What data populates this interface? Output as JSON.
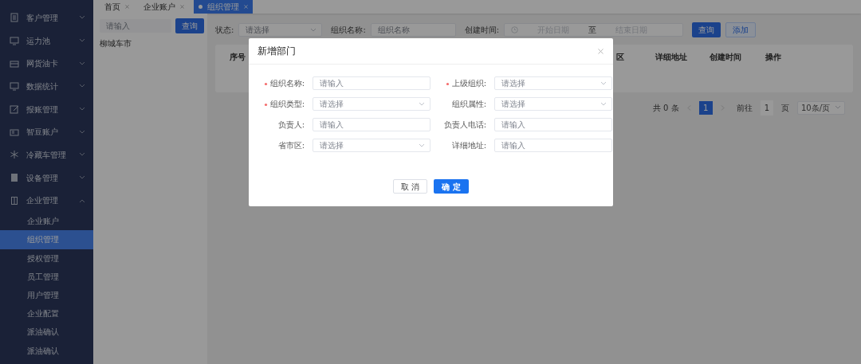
{
  "sidebar": {
    "items": [
      {
        "label": "客户管理",
        "expanded": false
      },
      {
        "label": "运力池",
        "expanded": false
      },
      {
        "label": "网货油卡",
        "expanded": false
      },
      {
        "label": "数据统计",
        "expanded": false
      },
      {
        "label": "报账管理",
        "expanded": false
      },
      {
        "label": "智豆账户",
        "expanded": false
      },
      {
        "label": "冷藏车管理",
        "expanded": false
      },
      {
        "label": "设备管理",
        "expanded": false
      },
      {
        "label": "企业管理",
        "expanded": true,
        "children": [
          {
            "label": "企业账户",
            "selected": false
          },
          {
            "label": "组织管理",
            "selected": true
          },
          {
            "label": "授权管理",
            "selected": false
          },
          {
            "label": "员工管理",
            "selected": false
          },
          {
            "label": "用户管理",
            "selected": false
          },
          {
            "label": "企业配置",
            "selected": false
          },
          {
            "label": "派油确认",
            "selected": false
          },
          {
            "label": "派油确认",
            "selected": false
          }
        ]
      }
    ]
  },
  "tabs": [
    {
      "label": "首页",
      "selected": false
    },
    {
      "label": "企业账户",
      "selected": false
    },
    {
      "label": "组织管理",
      "selected": true
    }
  ],
  "tree_panel": {
    "search": {
      "placeholder": "请输入"
    },
    "search_button": "查询",
    "nodes": [
      {
        "label": "柳城车市"
      }
    ]
  },
  "filters": {
    "status_label": "状态:",
    "status": {
      "placeholder": "请选择"
    },
    "name_label": "组织名称:",
    "name": {
      "placeholder": "组织名称"
    },
    "created_label": "创建时间:",
    "start": {
      "placeholder": "开始日期"
    },
    "range_separator": "至",
    "end": {
      "placeholder": "结束日期"
    },
    "buttons": [
      "查询",
      "添加"
    ]
  },
  "table": {
    "columns": [
      "序号",
      "区",
      "详细地址",
      "创建时间",
      "操作"
    ]
  },
  "pagination": {
    "total": "共 0 条",
    "pages": [
      {
        "label": "1",
        "selected": true
      }
    ],
    "goto_label": "前往",
    "goto_value": "1",
    "page_unit": "页",
    "page_size": "10条/页"
  },
  "dialog": {
    "title": "新增部门",
    "fields": [
      {
        "label": "组织名称:",
        "required": true,
        "kind": "input",
        "placeholder": "请输入"
      },
      {
        "label": "上级组织:",
        "required": true,
        "kind": "select",
        "placeholder": "请选择"
      },
      {
        "label": "组织类型:",
        "required": true,
        "kind": "select",
        "placeholder": "请选择"
      },
      {
        "label": "组织属性:",
        "required": false,
        "kind": "select",
        "placeholder": "请选择"
      },
      {
        "label": "负责人:",
        "required": false,
        "kind": "input",
        "placeholder": "请输入"
      },
      {
        "label": "负责人电话:",
        "required": false,
        "kind": "input",
        "placeholder": "请输入"
      },
      {
        "label": "省市区:",
        "required": false,
        "kind": "select",
        "placeholder": "请选择"
      },
      {
        "label": "详细地址:",
        "required": false,
        "kind": "input",
        "placeholder": "请输入"
      }
    ],
    "buttons": [
      {
        "label": "取 消",
        "kind": "secondary"
      },
      {
        "label": "确 定",
        "kind": "primary"
      }
    ]
  }
}
